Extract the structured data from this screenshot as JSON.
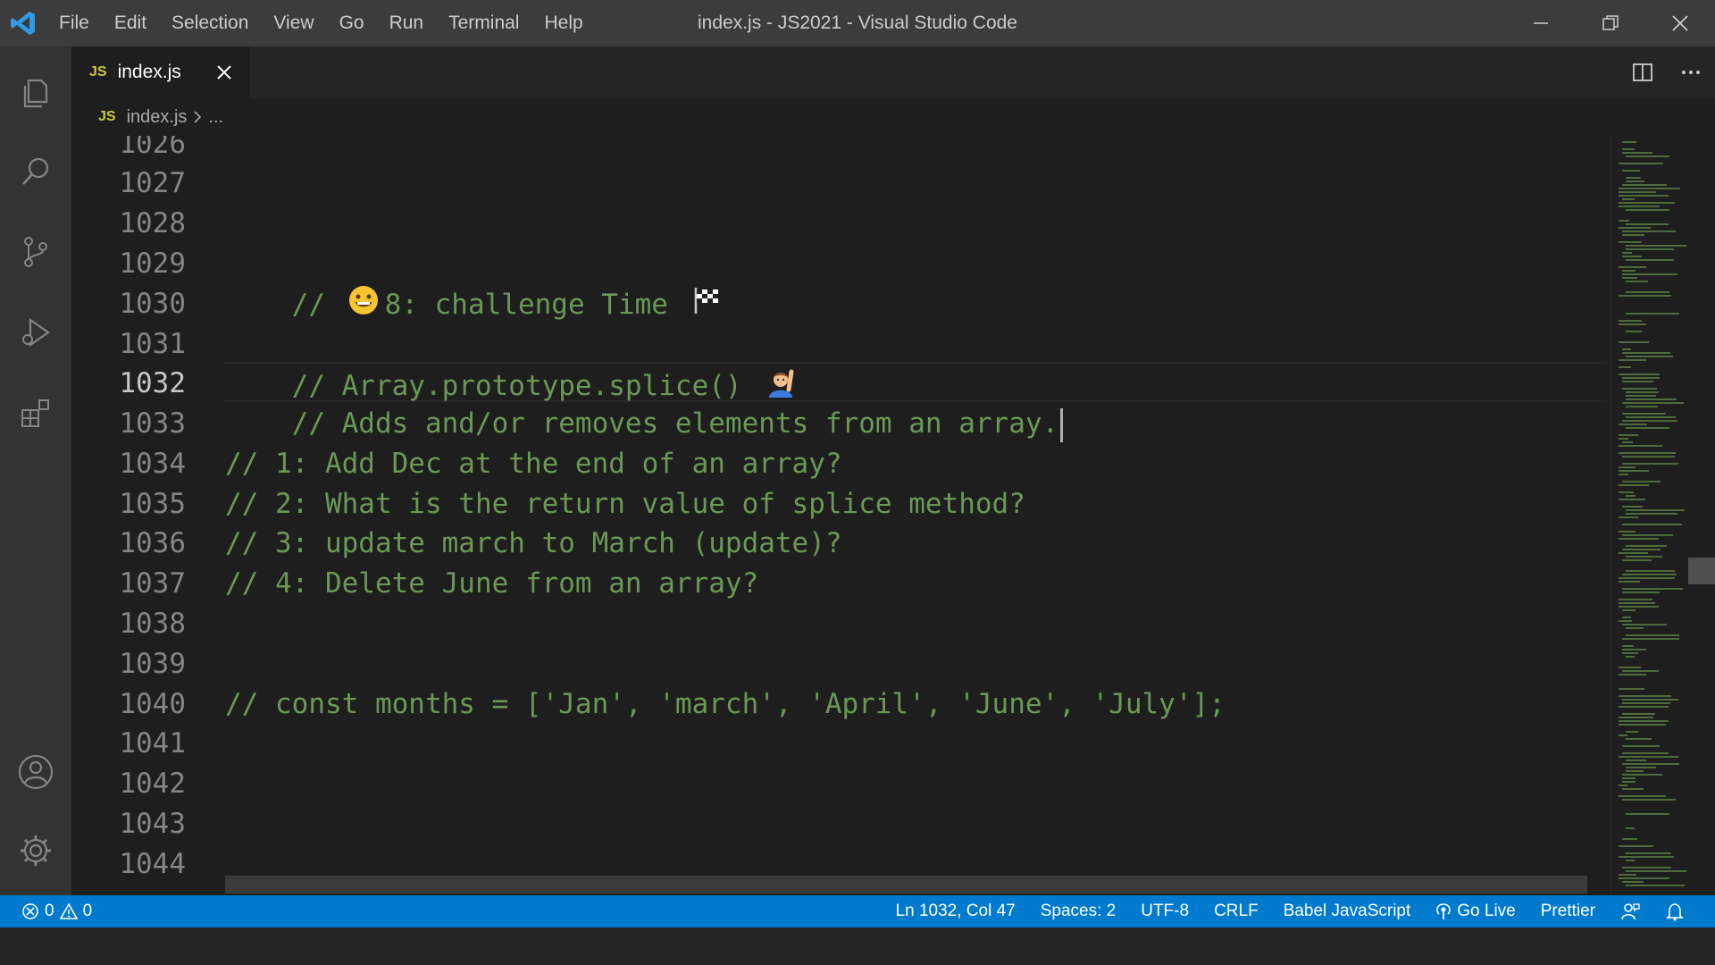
{
  "window": {
    "title": "index.js - JS2021 - Visual Studio Code"
  },
  "menu": [
    "File",
    "Edit",
    "Selection",
    "View",
    "Go",
    "Run",
    "Terminal",
    "Help"
  ],
  "activity_bar": {
    "top": [
      "explorer-icon",
      "search-icon",
      "source-control-icon",
      "run-debug-icon",
      "extensions-icon"
    ],
    "bottom": [
      "accounts-icon",
      "settings-gear-icon"
    ]
  },
  "tab": {
    "badge": "JS",
    "label": "index.js"
  },
  "breadcrumb": {
    "badge": "JS",
    "file": "index.js",
    "more": "..."
  },
  "editor": {
    "partial_top_line": "1026",
    "lines": [
      {
        "no": "1027",
        "text": ""
      },
      {
        "no": "1028",
        "text": ""
      },
      {
        "no": "1029",
        "prefix": "// ",
        "emoji": "grinning-face",
        "text": "8: challenge Time ",
        "emoji2": "checkered-flag"
      },
      {
        "no": "1030",
        "text": ""
      },
      {
        "no": "1031",
        "text": "// Array.prototype.splice() ",
        "emoji": "person-raising-hand"
      },
      {
        "no": "1032",
        "text": "// Adds and/or removes elements from an array."
      },
      {
        "no": "1033",
        "text": ""
      },
      {
        "no": "1034",
        "text": "// 1: Add Dec at the end of an array?"
      },
      {
        "no": "1035",
        "text": "// 2: What is the return value of splice method?"
      },
      {
        "no": "1036",
        "text": "// 3: update march to March (update)?"
      },
      {
        "no": "1037",
        "text": "// 4: Delete June from an array?"
      },
      {
        "no": "1038",
        "text": ""
      },
      {
        "no": "1039",
        "text": ""
      },
      {
        "no": "1040",
        "text": "// const months = ['Jan', 'march', 'April', 'June', 'July'];"
      },
      {
        "no": "1041",
        "text": ""
      },
      {
        "no": "1042",
        "text": ""
      },
      {
        "no": "1043",
        "text": ""
      },
      {
        "no": "1044",
        "text": ""
      }
    ],
    "active_line": "1032"
  },
  "status_bar": {
    "errors": "0",
    "warnings": "0",
    "position": "Ln 1032, Col 47",
    "spaces": "Spaces: 2",
    "encoding": "UTF-8",
    "eol": "CRLF",
    "language": "Babel JavaScript",
    "go_live": "Go Live",
    "formatter": "Prettier"
  },
  "colors": {
    "comment": "#6a9955",
    "status_bar": "#007acc",
    "title_bar": "#3c3c3c",
    "activity_bar": "#333333",
    "editor_bg": "#1e1e1e"
  }
}
